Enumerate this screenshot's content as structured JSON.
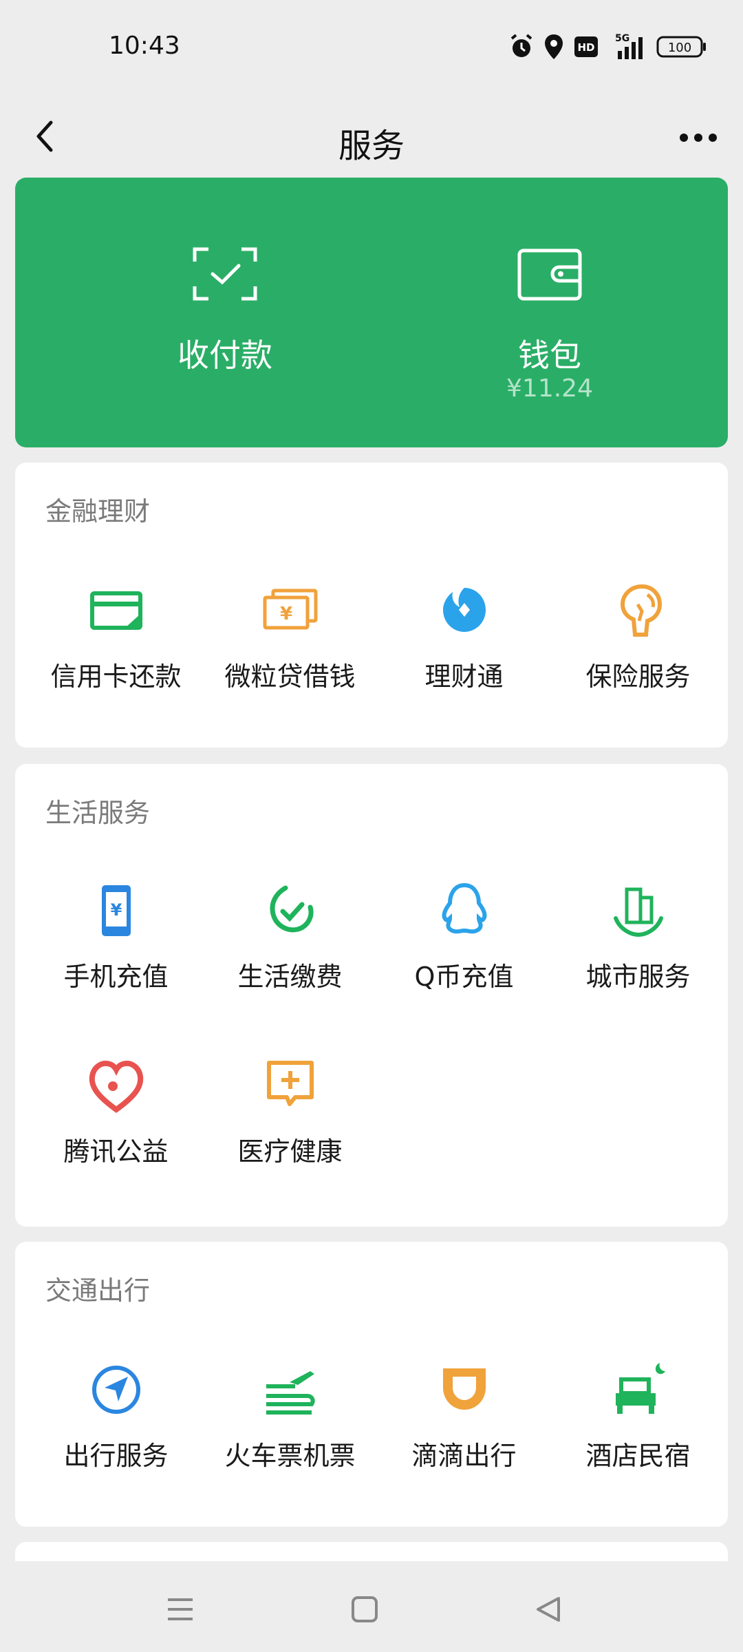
{
  "status_bar": {
    "time": "10:43",
    "network": "5G",
    "hd_badge": "HD",
    "battery": "100"
  },
  "header": {
    "title": "服务"
  },
  "wallet_card": {
    "pay": {
      "label": "收付款",
      "icon": "scan-check-icon"
    },
    "wallet": {
      "label": "钱包",
      "balance": "¥11.24",
      "icon": "wallet-icon"
    },
    "accent": "#2aae67"
  },
  "sections": [
    {
      "title": "金融理财",
      "items": [
        {
          "label": "信用卡还款",
          "icon": "credit-card-icon",
          "color": "#1fb35b"
        },
        {
          "label": "微粒贷借钱",
          "icon": "loan-icon",
          "color": "#f0a23b"
        },
        {
          "label": "理财通",
          "icon": "wealth-icon",
          "color": "#2ba3ea"
        },
        {
          "label": "保险服务",
          "icon": "insurance-icon",
          "color": "#f0a23b"
        }
      ]
    },
    {
      "title": "生活服务",
      "items": [
        {
          "label": "手机充值",
          "icon": "phone-topup-icon",
          "color": "#2b86e0"
        },
        {
          "label": "生活缴费",
          "icon": "utility-bill-icon",
          "color": "#1fb35b"
        },
        {
          "label": "Q币充值",
          "icon": "qq-coin-icon",
          "color": "#2ba3ea"
        },
        {
          "label": "城市服务",
          "icon": "city-service-icon",
          "color": "#1fb35b"
        },
        {
          "label": "腾讯公益",
          "icon": "charity-heart-icon",
          "color": "#e8534f"
        },
        {
          "label": "医疗健康",
          "icon": "medical-icon",
          "color": "#f0a23b"
        }
      ]
    },
    {
      "title": "交通出行",
      "items": [
        {
          "label": "出行服务",
          "icon": "navigation-icon",
          "color": "#2b86e0"
        },
        {
          "label": "火车票机票",
          "icon": "train-plane-icon",
          "color": "#1fb35b"
        },
        {
          "label": "滴滴出行",
          "icon": "didi-icon",
          "color": "#f0a23b"
        },
        {
          "label": "酒店民宿",
          "icon": "hotel-bed-icon",
          "color": "#1fb35b"
        }
      ]
    }
  ],
  "system_nav": {
    "buttons": [
      "menu-icon",
      "home-icon",
      "back-triangle-icon"
    ]
  }
}
